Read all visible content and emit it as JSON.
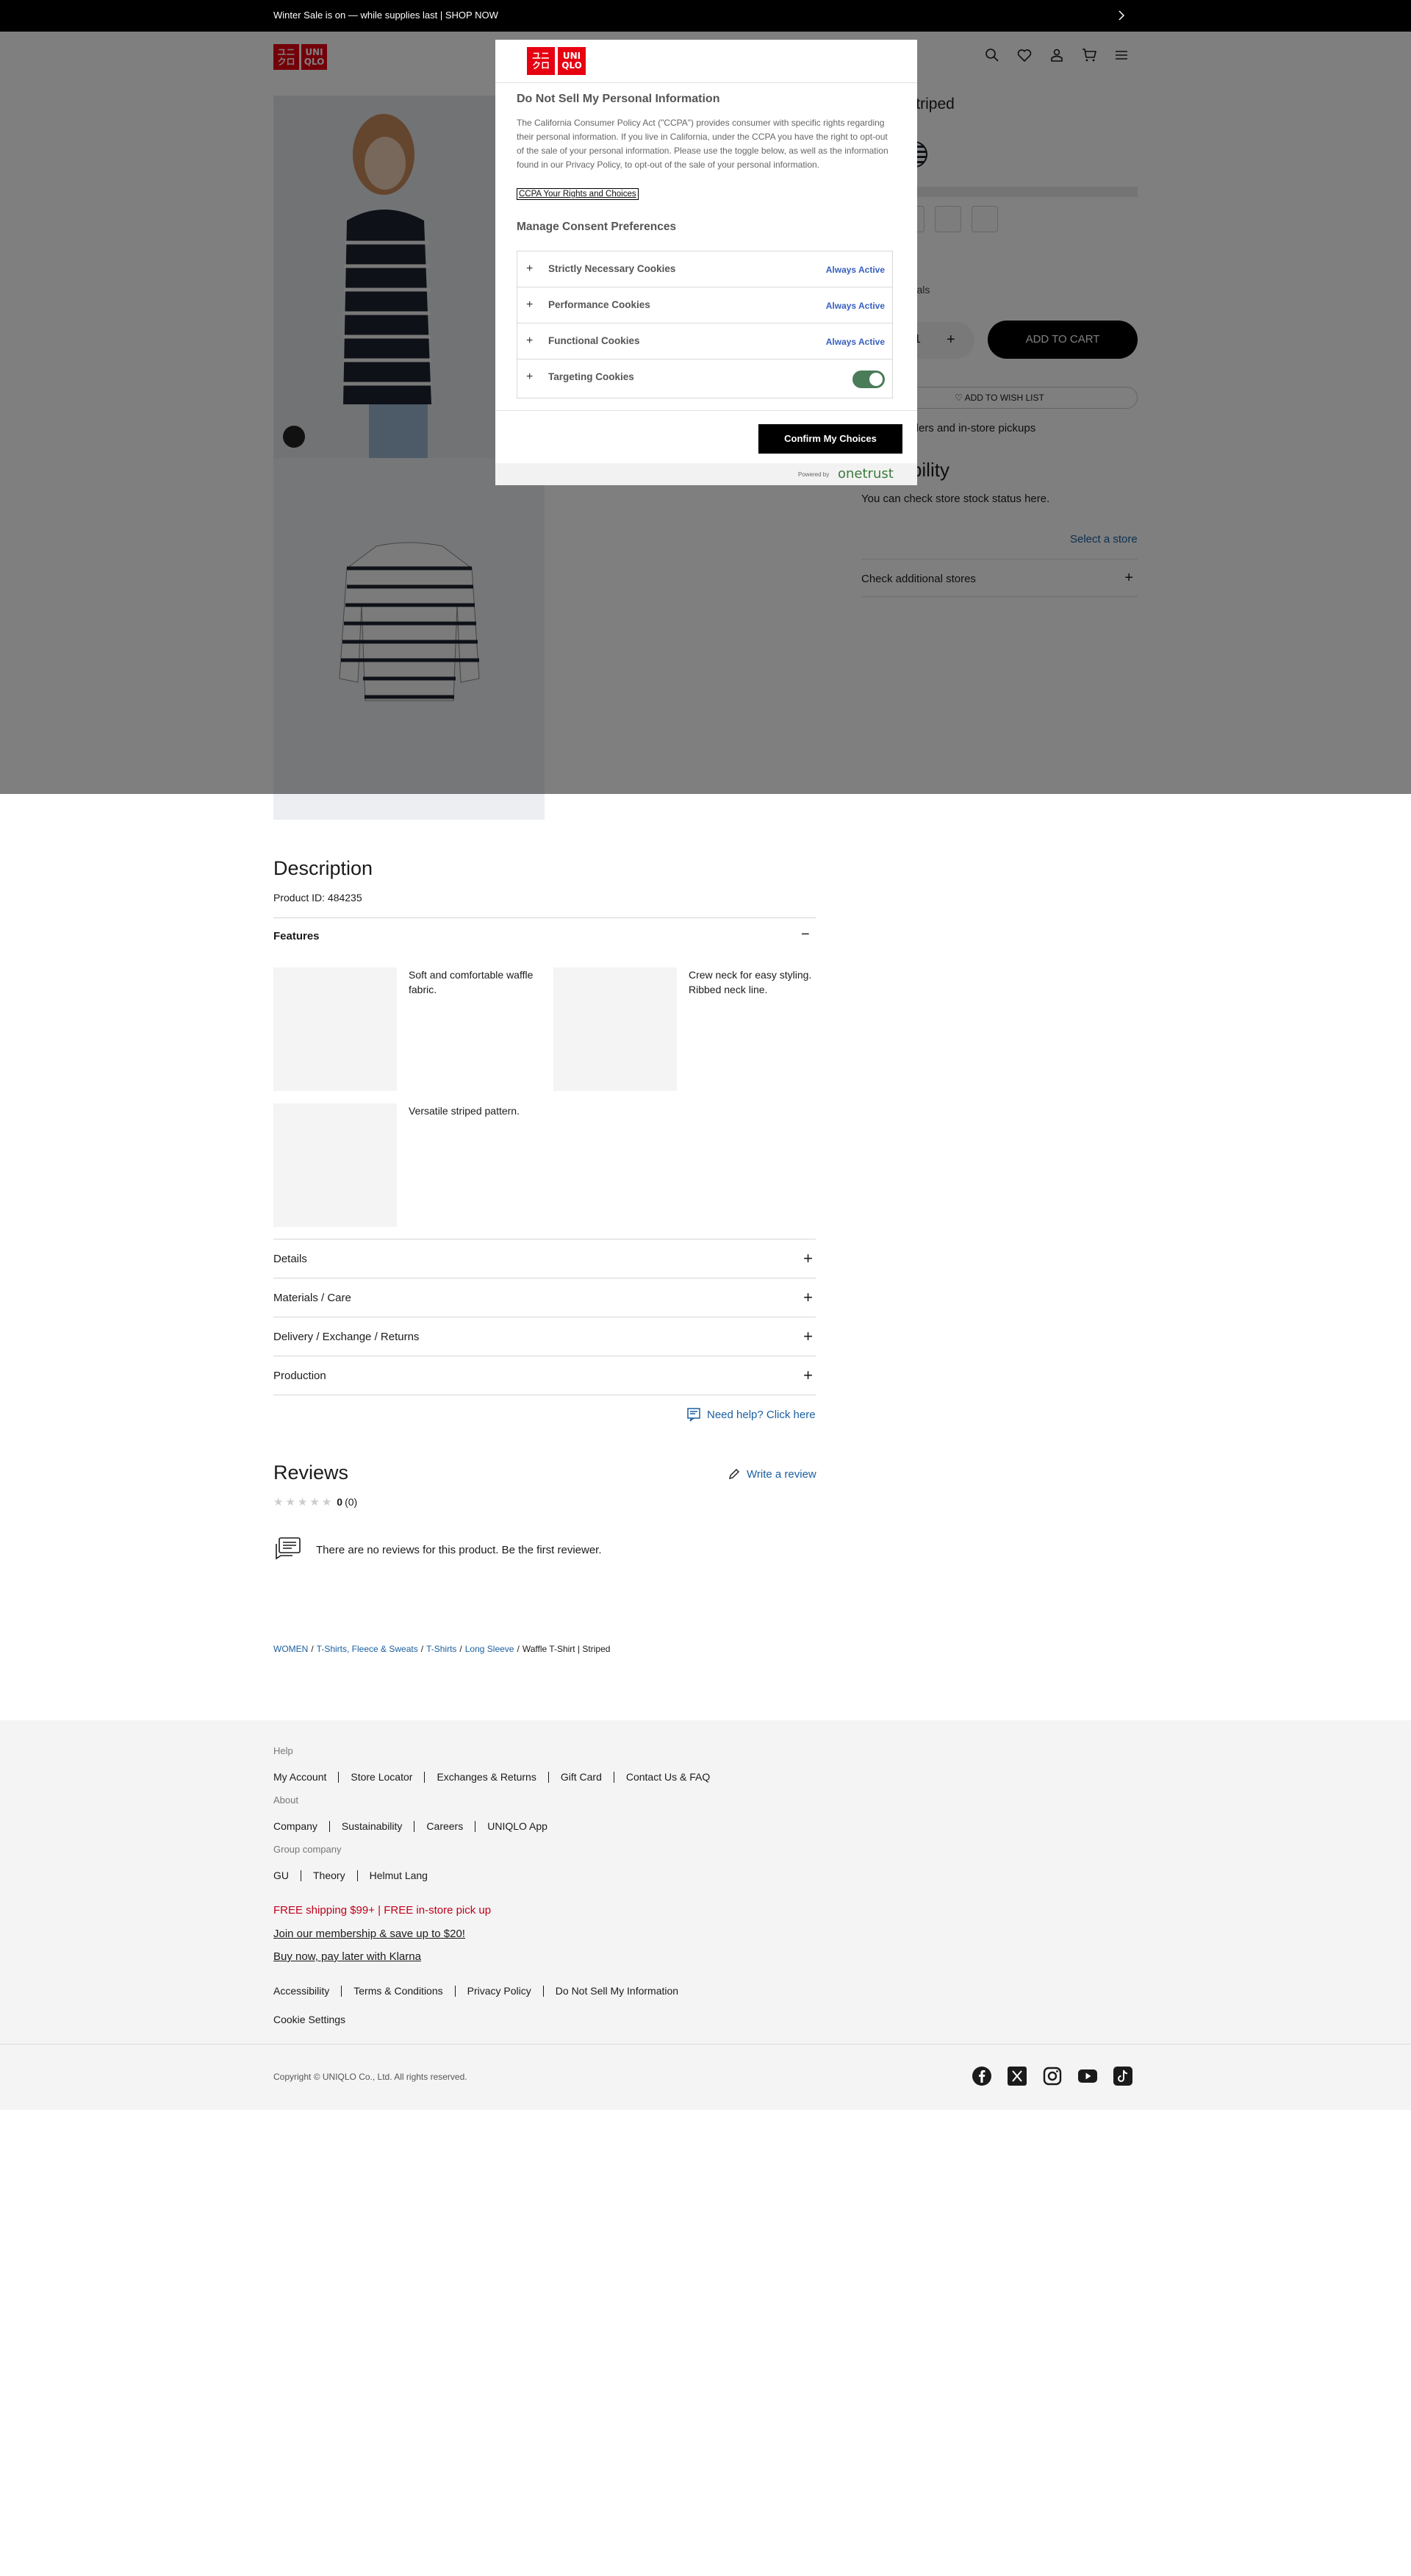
{
  "announcement": {
    "text": "Winter Sale is on — while supplies last | SHOP NOW"
  },
  "header": {
    "logo_left": "ユニ\nクロ",
    "logo_right": "UNI\nQLO"
  },
  "product": {
    "name_partial": "Shirt | Striped",
    "price_partial": "0",
    "materials_partial": "ycled materials",
    "quantity": "1",
    "add_to_cart": "ADD TO CART",
    "wishlist": "ADD TO WISH LIST",
    "ship_note": "E: $99+ orders and in-store pickups",
    "availability_title": "availability",
    "availability_sub": "You can check store stock status here.",
    "select_store": "Select a store",
    "check_additional": "Check additional stores"
  },
  "modal": {
    "title": "Do Not Sell My Personal Information",
    "description": "The California Consumer Policy Act (\"CCPA\") provides consumer with specific rights regarding their personal information. If you live in California, under the CCPA you have the right to opt-out of the sale of your personal information. Please use the toggle below, as well as the information found in our Privacy Policy, to opt-out of the sale of your personal information.",
    "ccpa_link": "CCPA Your Rights and Choices",
    "manage_title": "Manage Consent Preferences",
    "cookies": [
      {
        "label": "Strictly Necessary Cookies",
        "status": "Always Active"
      },
      {
        "label": "Performance Cookies",
        "status": "Always Active"
      },
      {
        "label": "Functional Cookies",
        "status": "Always Active"
      },
      {
        "label": "Targeting Cookies",
        "status": ""
      }
    ],
    "targeting_toggle_on": true,
    "confirm_button": "Confirm My Choices",
    "powered_by": "Powered by",
    "onetrust": "onetrust"
  },
  "description": {
    "title": "Description",
    "product_id": "Product ID: 484235",
    "features_label": "Features",
    "features": [
      {
        "text": "Soft and comfortable waffle fabric."
      },
      {
        "text": "Crew neck for easy styling. Ribbed neck line."
      },
      {
        "text": "Versatile striped pattern."
      }
    ],
    "accordions": [
      "Details",
      "Materials / Care",
      "Delivery / Exchange / Returns",
      "Production"
    ],
    "need_help": "Need help? Click here"
  },
  "reviews": {
    "title": "Reviews",
    "write_review": "Write a review",
    "rating": "0",
    "count": "(0)",
    "empty_text": "There are no reviews for this product. Be the first reviewer."
  },
  "breadcrumb": {
    "items": [
      "WOMEN",
      "T-Shirts, Fleece & Sweats",
      "T-Shirts",
      "Long Sleeve"
    ],
    "current": "Waffle T-Shirt | Striped"
  },
  "footer": {
    "help_label": "Help",
    "help_links": [
      "My Account",
      "Store Locator",
      "Exchanges & Returns",
      "Gift Card",
      "Contact Us & FAQ"
    ],
    "about_label": "About",
    "about_links": [
      "Company",
      "Sustainability",
      "Careers",
      "UNIQLO App"
    ],
    "group_label": "Group company",
    "group_links": [
      "GU",
      "Theory",
      "Helmut Lang"
    ],
    "promo_red": "FREE shipping $99+ | FREE in-store pick up",
    "promo_membership": "Join our membership & save up to $20!",
    "promo_klarna": "Buy now, pay later with Klarna",
    "legal_links": [
      "Accessibility",
      "Terms & Conditions",
      "Privacy Policy",
      "Do Not Sell My Information"
    ],
    "cookie_settings": "Cookie Settings",
    "copyright": "Copyright © UNIQLO Co., Ltd. All rights reserved."
  },
  "colors": {
    "brand_red": "#e60012",
    "link_blue": "#1a5fa0",
    "promo_red": "#c0001a",
    "toggle_green": "#4a7c59",
    "always_active": "#3860be"
  }
}
